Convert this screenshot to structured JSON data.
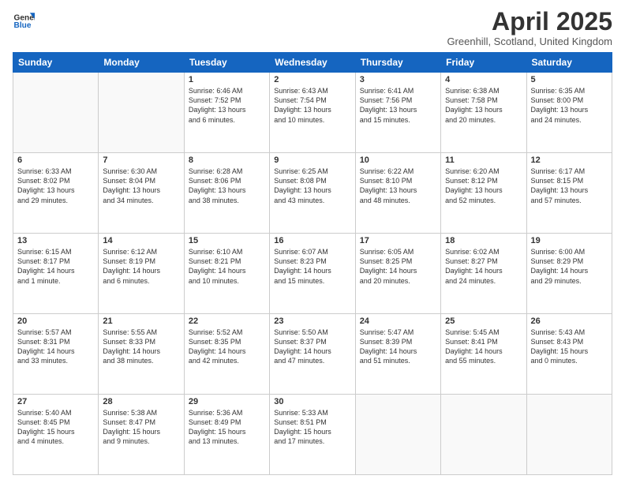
{
  "logo": {
    "general": "General",
    "blue": "Blue"
  },
  "header": {
    "month": "April 2025",
    "location": "Greenhill, Scotland, United Kingdom"
  },
  "weekdays": [
    "Sunday",
    "Monday",
    "Tuesday",
    "Wednesday",
    "Thursday",
    "Friday",
    "Saturday"
  ],
  "weeks": [
    [
      {
        "day": "",
        "info": ""
      },
      {
        "day": "",
        "info": ""
      },
      {
        "day": "1",
        "info": "Sunrise: 6:46 AM\nSunset: 7:52 PM\nDaylight: 13 hours\nand 6 minutes."
      },
      {
        "day": "2",
        "info": "Sunrise: 6:43 AM\nSunset: 7:54 PM\nDaylight: 13 hours\nand 10 minutes."
      },
      {
        "day": "3",
        "info": "Sunrise: 6:41 AM\nSunset: 7:56 PM\nDaylight: 13 hours\nand 15 minutes."
      },
      {
        "day": "4",
        "info": "Sunrise: 6:38 AM\nSunset: 7:58 PM\nDaylight: 13 hours\nand 20 minutes."
      },
      {
        "day": "5",
        "info": "Sunrise: 6:35 AM\nSunset: 8:00 PM\nDaylight: 13 hours\nand 24 minutes."
      }
    ],
    [
      {
        "day": "6",
        "info": "Sunrise: 6:33 AM\nSunset: 8:02 PM\nDaylight: 13 hours\nand 29 minutes."
      },
      {
        "day": "7",
        "info": "Sunrise: 6:30 AM\nSunset: 8:04 PM\nDaylight: 13 hours\nand 34 minutes."
      },
      {
        "day": "8",
        "info": "Sunrise: 6:28 AM\nSunset: 8:06 PM\nDaylight: 13 hours\nand 38 minutes."
      },
      {
        "day": "9",
        "info": "Sunrise: 6:25 AM\nSunset: 8:08 PM\nDaylight: 13 hours\nand 43 minutes."
      },
      {
        "day": "10",
        "info": "Sunrise: 6:22 AM\nSunset: 8:10 PM\nDaylight: 13 hours\nand 48 minutes."
      },
      {
        "day": "11",
        "info": "Sunrise: 6:20 AM\nSunset: 8:12 PM\nDaylight: 13 hours\nand 52 minutes."
      },
      {
        "day": "12",
        "info": "Sunrise: 6:17 AM\nSunset: 8:15 PM\nDaylight: 13 hours\nand 57 minutes."
      }
    ],
    [
      {
        "day": "13",
        "info": "Sunrise: 6:15 AM\nSunset: 8:17 PM\nDaylight: 14 hours\nand 1 minute."
      },
      {
        "day": "14",
        "info": "Sunrise: 6:12 AM\nSunset: 8:19 PM\nDaylight: 14 hours\nand 6 minutes."
      },
      {
        "day": "15",
        "info": "Sunrise: 6:10 AM\nSunset: 8:21 PM\nDaylight: 14 hours\nand 10 minutes."
      },
      {
        "day": "16",
        "info": "Sunrise: 6:07 AM\nSunset: 8:23 PM\nDaylight: 14 hours\nand 15 minutes."
      },
      {
        "day": "17",
        "info": "Sunrise: 6:05 AM\nSunset: 8:25 PM\nDaylight: 14 hours\nand 20 minutes."
      },
      {
        "day": "18",
        "info": "Sunrise: 6:02 AM\nSunset: 8:27 PM\nDaylight: 14 hours\nand 24 minutes."
      },
      {
        "day": "19",
        "info": "Sunrise: 6:00 AM\nSunset: 8:29 PM\nDaylight: 14 hours\nand 29 minutes."
      }
    ],
    [
      {
        "day": "20",
        "info": "Sunrise: 5:57 AM\nSunset: 8:31 PM\nDaylight: 14 hours\nand 33 minutes."
      },
      {
        "day": "21",
        "info": "Sunrise: 5:55 AM\nSunset: 8:33 PM\nDaylight: 14 hours\nand 38 minutes."
      },
      {
        "day": "22",
        "info": "Sunrise: 5:52 AM\nSunset: 8:35 PM\nDaylight: 14 hours\nand 42 minutes."
      },
      {
        "day": "23",
        "info": "Sunrise: 5:50 AM\nSunset: 8:37 PM\nDaylight: 14 hours\nand 47 minutes."
      },
      {
        "day": "24",
        "info": "Sunrise: 5:47 AM\nSunset: 8:39 PM\nDaylight: 14 hours\nand 51 minutes."
      },
      {
        "day": "25",
        "info": "Sunrise: 5:45 AM\nSunset: 8:41 PM\nDaylight: 14 hours\nand 55 minutes."
      },
      {
        "day": "26",
        "info": "Sunrise: 5:43 AM\nSunset: 8:43 PM\nDaylight: 15 hours\nand 0 minutes."
      }
    ],
    [
      {
        "day": "27",
        "info": "Sunrise: 5:40 AM\nSunset: 8:45 PM\nDaylight: 15 hours\nand 4 minutes."
      },
      {
        "day": "28",
        "info": "Sunrise: 5:38 AM\nSunset: 8:47 PM\nDaylight: 15 hours\nand 9 minutes."
      },
      {
        "day": "29",
        "info": "Sunrise: 5:36 AM\nSunset: 8:49 PM\nDaylight: 15 hours\nand 13 minutes."
      },
      {
        "day": "30",
        "info": "Sunrise: 5:33 AM\nSunset: 8:51 PM\nDaylight: 15 hours\nand 17 minutes."
      },
      {
        "day": "",
        "info": ""
      },
      {
        "day": "",
        "info": ""
      },
      {
        "day": "",
        "info": ""
      }
    ]
  ]
}
